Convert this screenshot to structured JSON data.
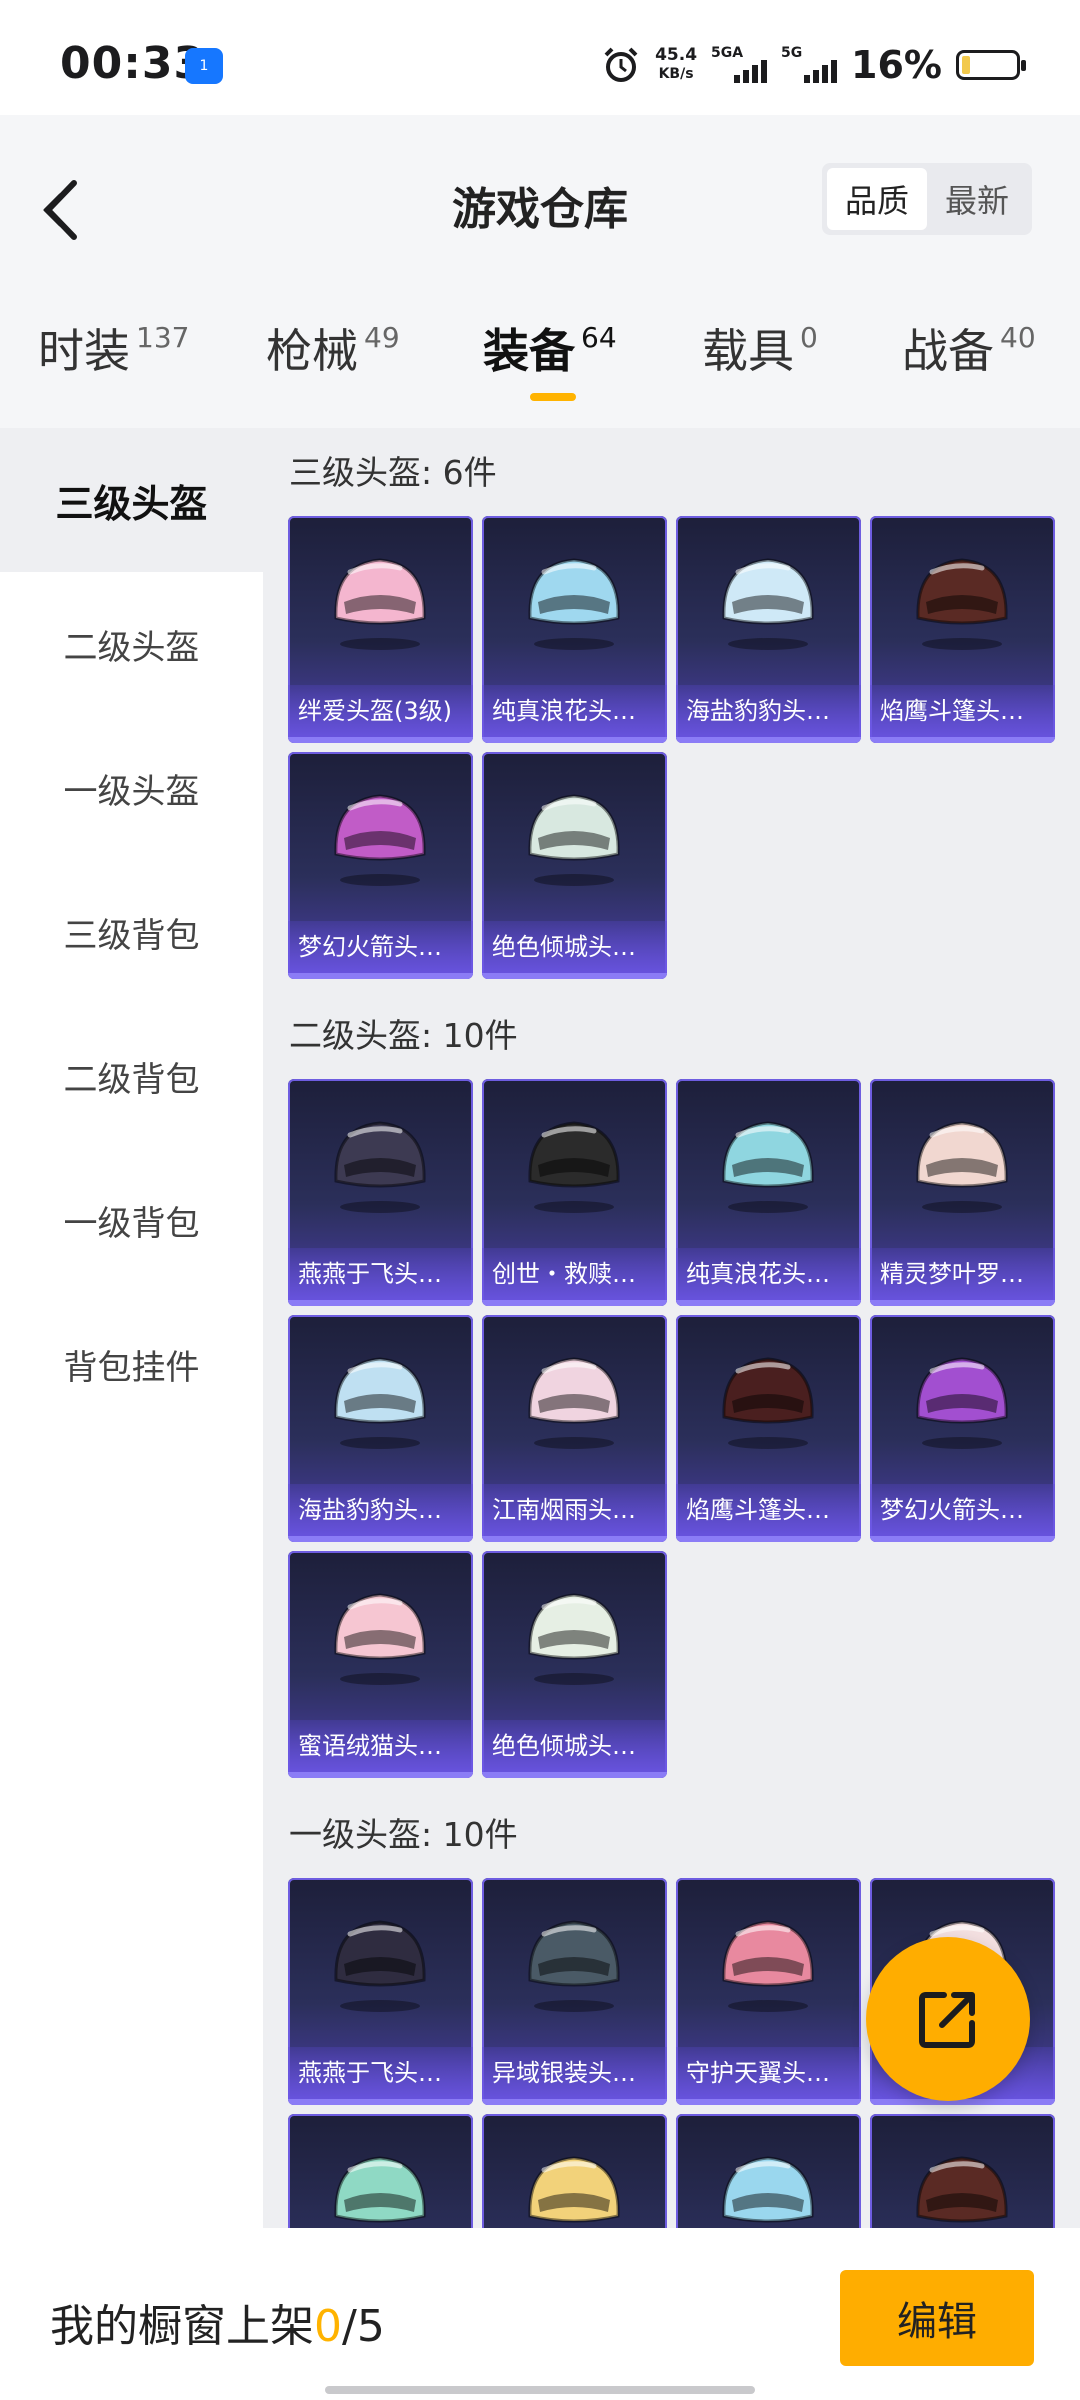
{
  "status_bar": {
    "time": "00:33",
    "app_badge": "1",
    "speed_value": "45.4",
    "speed_unit": "KB/s",
    "sim1_label": "5GA",
    "sim2_label": "5G",
    "battery_percent": "16%",
    "battery_level": 0.16
  },
  "header": {
    "title": "游戏仓库",
    "sort_options": [
      "品质",
      "最新"
    ],
    "sort_active": "品质"
  },
  "tabs": [
    {
      "label": "时装",
      "count": "137"
    },
    {
      "label": "枪械",
      "count": "49"
    },
    {
      "label": "装备",
      "count": "64"
    },
    {
      "label": "载具",
      "count": "0"
    },
    {
      "label": "战备",
      "count": "40"
    }
  ],
  "active_tab": "装备",
  "sidebar": [
    {
      "label": "三级头盔"
    },
    {
      "label": "二级头盔"
    },
    {
      "label": "一级头盔"
    },
    {
      "label": "三级背包"
    },
    {
      "label": "二级背包"
    },
    {
      "label": "一级背包"
    },
    {
      "label": "背包挂件"
    }
  ],
  "sections": [
    {
      "title": "三级头盔: 6件",
      "items": [
        {
          "name": "绊爱头盔(3级)",
          "color": "#f4b6cf"
        },
        {
          "name": "纯真浪花头…",
          "color": "#9fd8ef"
        },
        {
          "name": "海盐豹豹头…",
          "color": "#cfe9f7"
        },
        {
          "name": "焰鹰斗篷头…",
          "color": "#5a2a24"
        },
        {
          "name": "梦幻火箭头…",
          "color": "#c15cc7"
        },
        {
          "name": "绝色倾城头…",
          "color": "#d8e8e0"
        }
      ]
    },
    {
      "title": "二级头盔: 10件",
      "items": [
        {
          "name": "燕燕于飞头…",
          "color": "#3d3a52"
        },
        {
          "name": "创世・救赎…",
          "color": "#2b2b2b"
        },
        {
          "name": "纯真浪花头…",
          "color": "#8fd6e0"
        },
        {
          "name": "精灵梦叶罗…",
          "color": "#f1d7d0"
        },
        {
          "name": "海盐豹豹头…",
          "color": "#bfe0f2"
        },
        {
          "name": "江南烟雨头…",
          "color": "#f0d4e0"
        },
        {
          "name": "焰鹰斗篷头…",
          "color": "#4a1f1f"
        },
        {
          "name": "梦幻火箭头…",
          "color": "#a24fd0"
        },
        {
          "name": "蜜语绒猫头…",
          "color": "#f6c6d2"
        },
        {
          "name": "绝色倾城头…",
          "color": "#e6efe4"
        }
      ]
    },
    {
      "title": "一级头盔: 10件",
      "items": [
        {
          "name": "燕燕于飞头…",
          "color": "#2f2c40"
        },
        {
          "name": "异域银装头…",
          "color": "#4a5a66"
        },
        {
          "name": "守护天翼头…",
          "color": "#e8899f"
        },
        {
          "name": "",
          "color": "#f3dfe0"
        },
        {
          "name": "",
          "color": "#8fd9c4"
        },
        {
          "name": "",
          "color": "#f2d27a"
        },
        {
          "name": "",
          "color": "#9ad7ee"
        },
        {
          "name": "",
          "color": "#5a2a24"
        }
      ]
    }
  ],
  "bottom": {
    "showcase_prefix": "我的橱窗上架",
    "showcase_count": "0",
    "showcase_total": "/5",
    "edit_label": "编辑"
  }
}
